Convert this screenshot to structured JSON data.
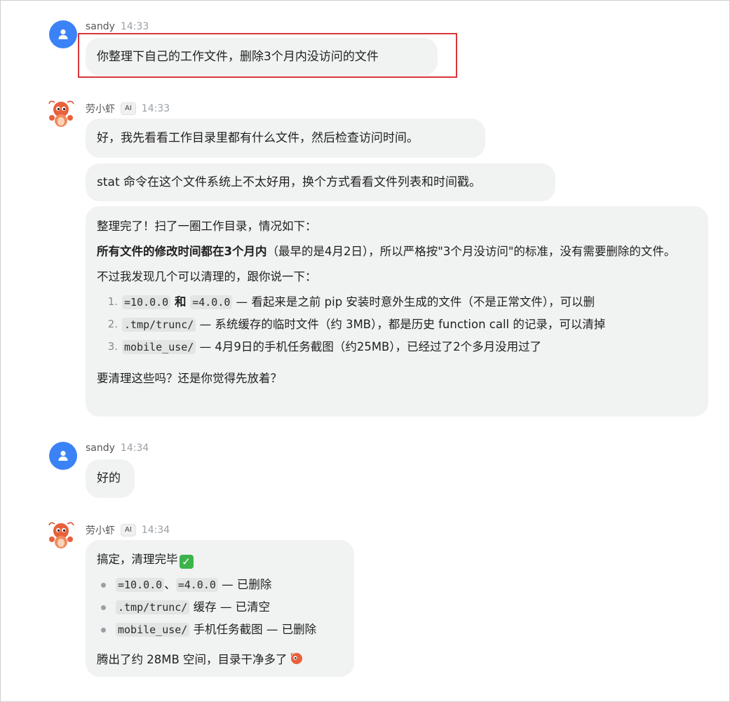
{
  "messages": [
    {
      "sender": "sandy",
      "time": "14:33",
      "text": "你整理下自己的工作文件，删除3个月内没访问的文件"
    },
    {
      "sender": "劳小虾",
      "badge": "AI",
      "time": "14:33",
      "bubble1": "好，我先看看工作目录里都有什么文件，然后检查访问时间。",
      "bubble2": "stat 命令在这个文件系统上不太好用，换个方式看看文件列表和时间戳。",
      "report": {
        "intro": "整理完了！扫了一圈工作目录，情况如下：",
        "summary_bold": "所有文件的修改时间都在3个月内",
        "summary_rest": "（最早的是4月2日），所以严格按\"3个月没访问\"的标准，没有需要删除的文件。",
        "found": "不过我发现几个可以清理的，跟你说一下：",
        "items": [
          {
            "num": "1.",
            "code1": "=10.0.0",
            "mid": " 和 ",
            "code2": "=4.0.0",
            "text": " — 看起来是之前 pip 安装时意外生成的文件（不是正常文件），可以删"
          },
          {
            "num": "2.",
            "code1": ".tmp/trunc/",
            "text": " — 系统缓存的临时文件（约 3MB），都是历史 function call 的记录，可以清掉"
          },
          {
            "num": "3.",
            "code1": "mobile_use/",
            "text": " — 4月9日的手机任务截图（约25MB），已经过了2个多月没用过了"
          }
        ],
        "question": "要清理这些吗？还是你觉得先放着？"
      }
    },
    {
      "sender": "sandy",
      "time": "14:34",
      "text": "好的"
    },
    {
      "sender": "劳小虾",
      "badge": "AI",
      "time": "14:34",
      "done": {
        "title": "搞定，清理完毕",
        "bullets": [
          {
            "code1": "=10.0.0",
            "sep": "、",
            "code2": "=4.0.0",
            "text": " — 已删除"
          },
          {
            "code1": ".tmp/trunc/",
            "text": " 缓存 — 已清空"
          },
          {
            "code1": "mobile_use/",
            "text": " 手机任务截图 — 已删除"
          }
        ],
        "footer": "腾出了约 28MB 空间，目录干净多了"
      }
    }
  ],
  "colors": {
    "user_avatar": "#3b82f6",
    "highlight": "#d8363a",
    "bubble": "#f1f2f2"
  }
}
